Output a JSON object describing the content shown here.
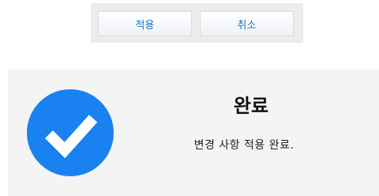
{
  "buttons": {
    "apply_label": "적용",
    "cancel_label": "취소",
    "label_color": "#1a73c9"
  },
  "dialog": {
    "title": "완료",
    "message": "변경 사항 적용 완료.",
    "icon": "check-circle-icon",
    "icon_color": "#1a82f0",
    "background": "#f4f4f4"
  }
}
